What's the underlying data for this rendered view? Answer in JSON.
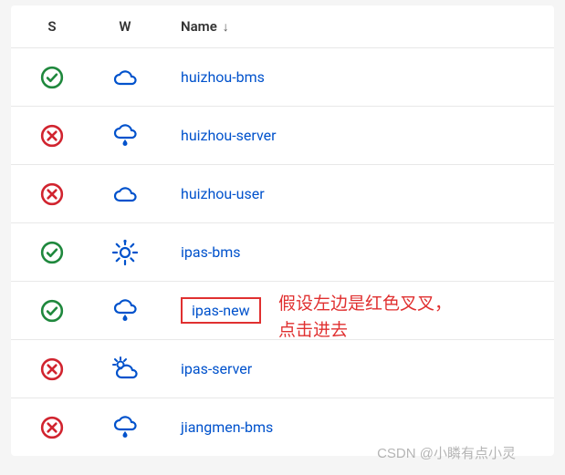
{
  "header": {
    "s_label": "S",
    "w_label": "W",
    "name_label": "Name",
    "sort_glyph": "↓"
  },
  "rows": [
    {
      "status": "success",
      "weather": "cloud",
      "name": "huizhou-bms"
    },
    {
      "status": "error",
      "weather": "rain",
      "name": "huizhou-server"
    },
    {
      "status": "error",
      "weather": "cloud",
      "name": "huizhou-user"
    },
    {
      "status": "success",
      "weather": "sun",
      "name": "ipas-bms"
    },
    {
      "status": "success",
      "weather": "rain",
      "name": "ipas-new",
      "highlighted": true
    },
    {
      "status": "error",
      "weather": "partly",
      "name": "ipas-server"
    },
    {
      "status": "error",
      "weather": "rain",
      "name": "jiangmen-bms"
    }
  ],
  "annotation": {
    "line1": "假设左边是红色叉叉，",
    "line2": "点击进去"
  },
  "watermark": "CSDN @小瞵有点小灵",
  "colors": {
    "success": "#1f883d",
    "error": "#d1242f",
    "icon": "#0052cc",
    "link": "#0052cc",
    "highlight": "#e03030"
  }
}
